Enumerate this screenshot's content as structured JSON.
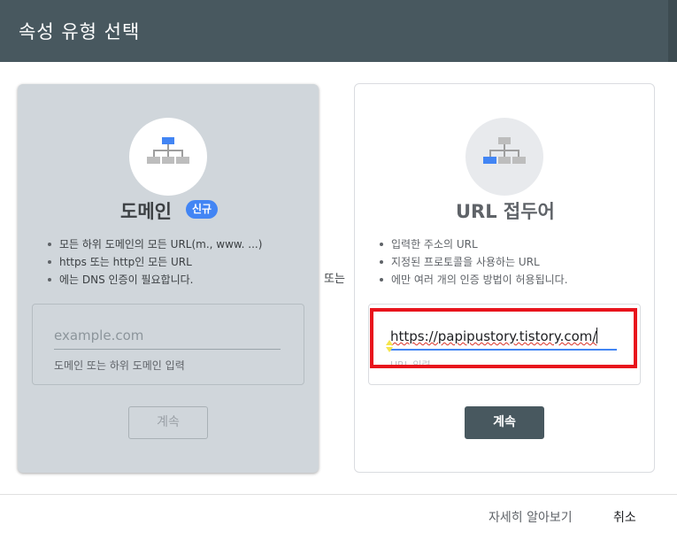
{
  "dialog": {
    "title": "속성 유형 선택"
  },
  "domain_card": {
    "icon": "sitemap-icon",
    "title": "도메인",
    "badge": "신규",
    "bullets": [
      "모든 하위 도메인의 모든 URL(m., www. ...)",
      "https 또는 http인 모든 URL",
      "에는 DNS 인증이 필요합니다."
    ],
    "input": {
      "placeholder": "example.com",
      "value": ""
    },
    "helper": "도메인 또는 하위 도메인 입력",
    "continue_label": "계속"
  },
  "separator": {
    "label": "또는"
  },
  "url_card": {
    "icon": "sitemap-icon",
    "title": "URL 접두어",
    "bullets": [
      "입력한 주소의 URL",
      "지정된 프로토콜을 사용하는 URL",
      "에만 여러 개의 인증 방법이 허용됩니다."
    ],
    "input": {
      "value": "https://papipustory.tistory.com/"
    },
    "helper": "URL 입력",
    "continue_label": "계속"
  },
  "footer": {
    "learn_more": "자세히 알아보기",
    "cancel": "취소"
  },
  "colors": {
    "header": "#48585f",
    "accent": "#4285f4",
    "highlight_box": "#e8141c"
  }
}
